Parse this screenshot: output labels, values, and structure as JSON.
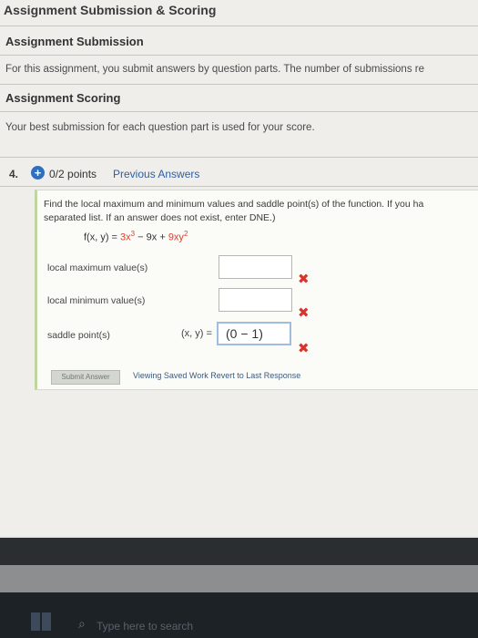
{
  "header": {
    "title": "Assignment Submission & Scoring"
  },
  "submission": {
    "title": "Assignment Submission",
    "text": "For this assignment, you submit answers by question parts. The number of submissions re"
  },
  "scoring": {
    "title": "Assignment Scoring",
    "text": "Your best submission for each question part is used for your score."
  },
  "question": {
    "number": "4.",
    "points": "0/2 points",
    "previous_answers": "Previous Answers",
    "instruction_line1": "Find the local maximum and minimum values and saddle point(s) of the function. If you ha",
    "instruction_line2": "separated list. If an answer does not exist, enter DNE.)",
    "function_prefix": "f(x, y) = ",
    "function_terms": [
      "3x",
      "3",
      " − 9x + ",
      "9xy",
      "2"
    ],
    "fields": [
      {
        "label": "local maximum value(s)",
        "value": "",
        "status_icon": "x-icon"
      },
      {
        "label": "local minimum value(s)",
        "value": "",
        "status_icon": "x-icon"
      },
      {
        "label": "saddle point(s)",
        "prefix": "(x, y) = ",
        "value": "(0 − 1)",
        "status_icon": "x-icon"
      }
    ],
    "mark": "✖",
    "submit_label": "Submit Answer",
    "viewing_text": "Viewing Saved Work",
    "revert_text": "Revert to Last Response"
  },
  "taskbar": {
    "search_placeholder": "Type here to search"
  },
  "colors": {
    "accent": "#2f6fbf",
    "error": "#d9342b",
    "link": "#2d5fa4"
  }
}
